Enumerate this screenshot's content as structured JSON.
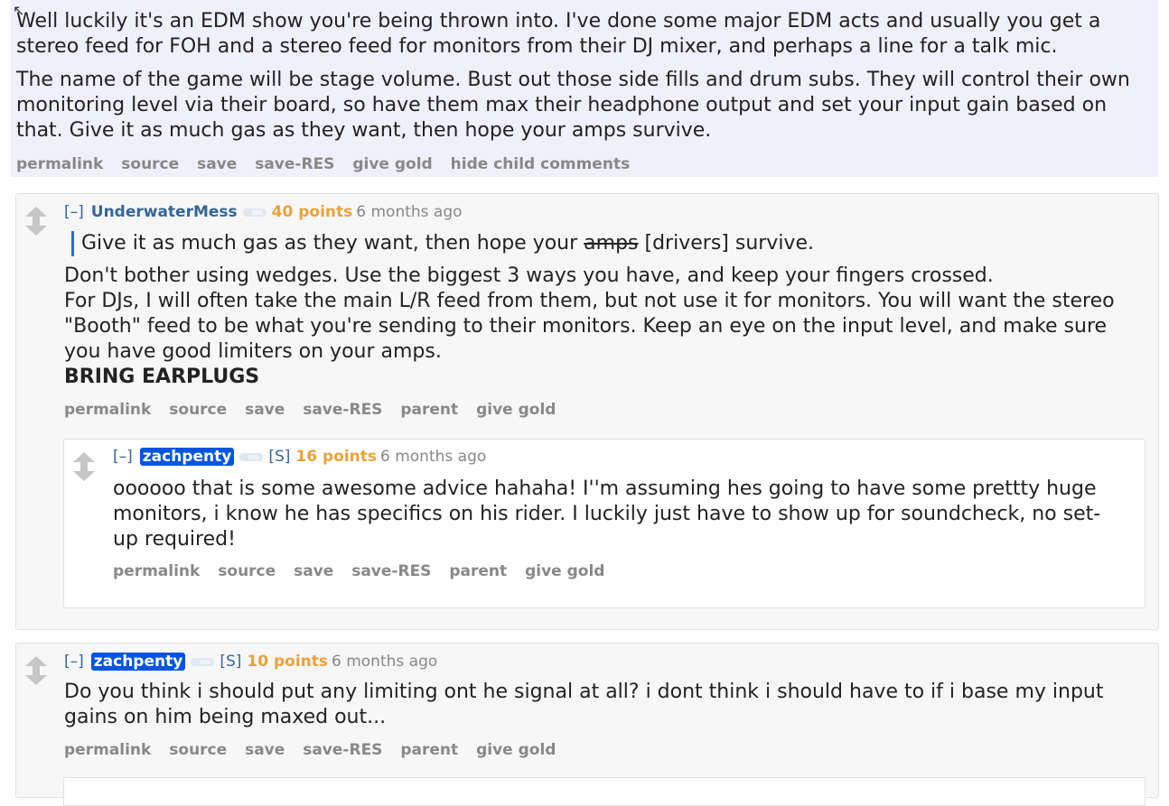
{
  "top_comment": {
    "paragraphs": [
      "Well luckily it's an EDM show you're being thrown into. I've done some major EDM acts and usually you get a stereo feed for FOH and a stereo feed for monitors from their DJ mixer, and perhaps a line for a talk mic.",
      "The name of the game will be stage volume. Bust out those side fills and drum subs. They will control their own monitoring level via their board, so have them max their headphone output and set your input gain based on that. Give it as much gas as they want, then hope your amps survive."
    ],
    "buttons": [
      "permalink",
      "source",
      "save",
      "save-RES",
      "give gold",
      "hide child comments"
    ]
  },
  "comment1": {
    "expand": "[–]",
    "author": "UnderwaterMess",
    "score": "40 points",
    "time": "6 months ago",
    "quote_before": "Give it as much gas as they want, then hope your ",
    "quote_struck": "amps",
    "quote_after": " [drivers] survive.",
    "line1": "Don't bother using wedges. Use the biggest 3 ways you have, and keep your fingers crossed.",
    "line2": "For DJs, I will often take the main L/R feed from them, but not use it for monitors. You will want the stereo \"Booth\" feed to be what you're sending to their monitors. Keep an eye on the input level, and make sure you have good limiters on your amps.",
    "line3": "BRING EARPLUGS",
    "buttons": [
      "permalink",
      "source",
      "save",
      "save-RES",
      "parent",
      "give gold"
    ]
  },
  "comment1_reply": {
    "expand": "[–]",
    "author": "zachpenty",
    "submitter": "[S]",
    "score": "16 points",
    "time": "6 months ago",
    "text": "oooooo that is some awesome advice hahaha! I''m assuming hes going to have some prettty huge monitors, i know he has specifics on his rider. I luckily just have to show up for soundcheck, no set-up required!",
    "buttons": [
      "permalink",
      "source",
      "save",
      "save-RES",
      "parent",
      "give gold"
    ]
  },
  "comment2": {
    "expand": "[–]",
    "author": "zachpenty",
    "submitter": "[S]",
    "score": "10 points",
    "time": "6 months ago",
    "text": "Do you think i should put any limiting ont he signal at all? i dont think i should have to if i base my input gains on him being maxed out...",
    "buttons": [
      "permalink",
      "source",
      "save",
      "save-RES",
      "parent",
      "give gold"
    ]
  }
}
